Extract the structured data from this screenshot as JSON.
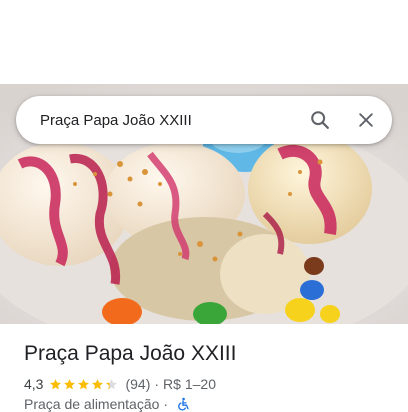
{
  "search": {
    "query": "Praça Papa João XXIII"
  },
  "place": {
    "name": "Praça Papa João XXIII",
    "rating": "4,3",
    "stars_value": 4.3,
    "review_count": "(94)",
    "separator": "·",
    "price_range": "R$ 1–20",
    "category": "Praça de alimentação",
    "category_separator": "·"
  },
  "icons": {
    "search": "search-icon",
    "close": "close-icon",
    "star": "star-icon",
    "accessibility": "wheelchair-icon"
  },
  "colors": {
    "star": "#fbbc04",
    "accessibility": "#1a73e8",
    "title": "#202124",
    "secondary": "#5f6368"
  }
}
